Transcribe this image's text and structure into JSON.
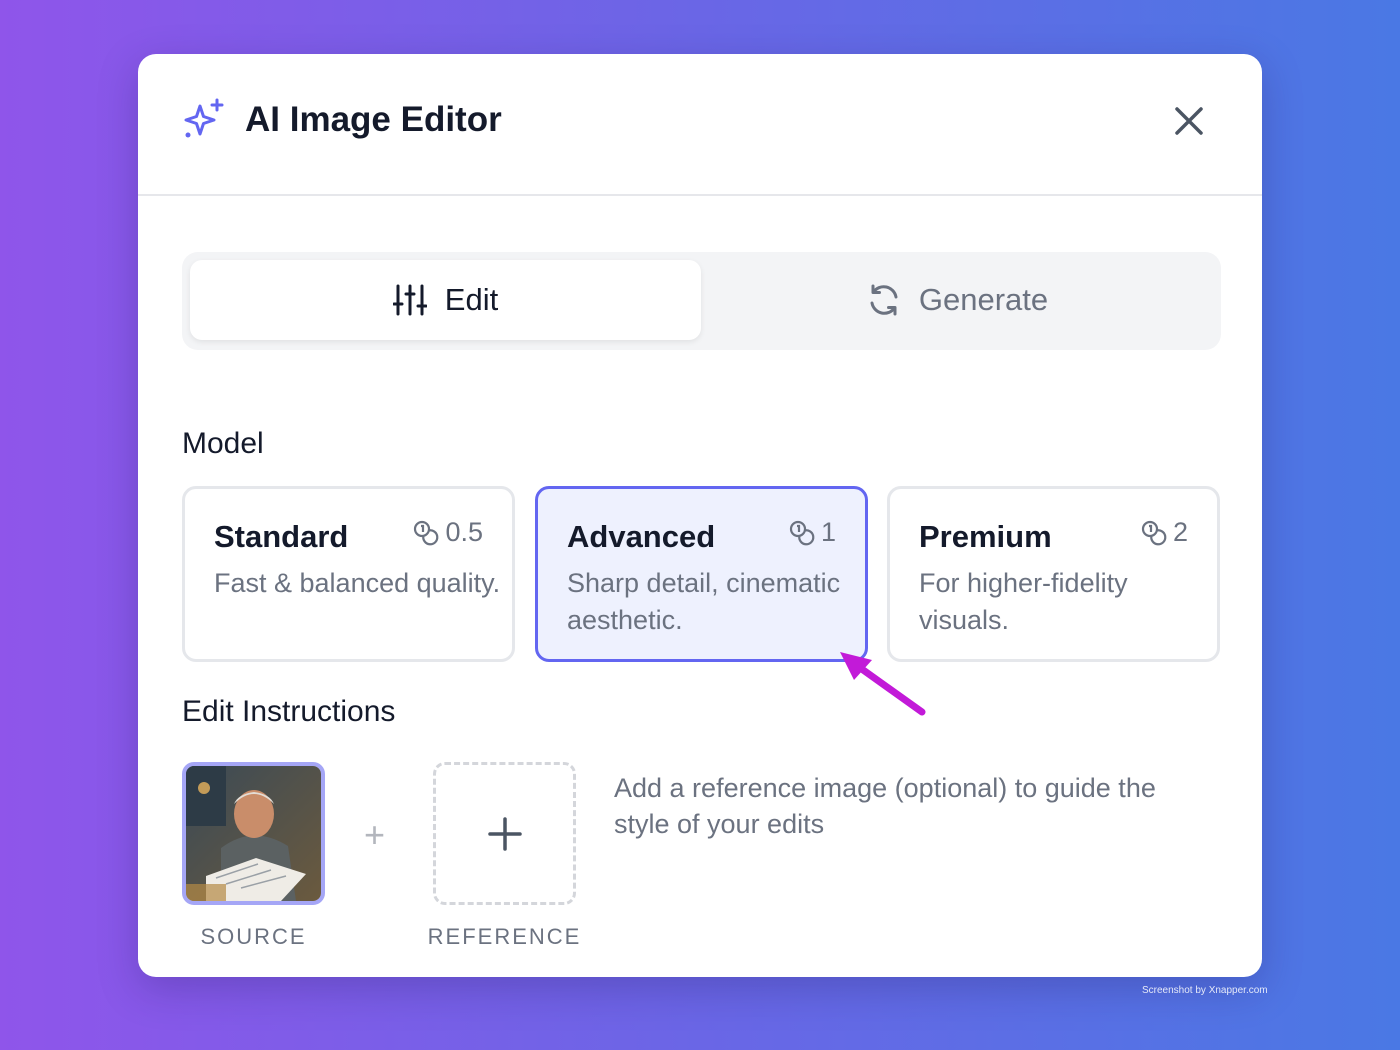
{
  "dialog": {
    "title": "AI Image Editor"
  },
  "tabs": [
    {
      "label": "Edit",
      "icon": "sliders-icon",
      "active": true
    },
    {
      "label": "Generate",
      "icon": "refresh-icon",
      "active": false
    }
  ],
  "model": {
    "label": "Model",
    "options": [
      {
        "name": "Standard",
        "cost": "0.5",
        "description": "Fast & balanced quality.",
        "selected": false
      },
      {
        "name": "Advanced",
        "cost": "1",
        "description": "Sharp detail, cinematic aesthetic.",
        "selected": true
      },
      {
        "name": "Premium",
        "cost": "2",
        "description": "For higher-fidelity visuals.",
        "selected": false
      }
    ]
  },
  "edit_instructions": {
    "label": "Edit Instructions",
    "source_caption": "SOURCE",
    "reference_caption": "REFERENCE",
    "separator": "+",
    "hint": "Add a reference image (optional) to guide the style of your edits"
  },
  "watermark": "Screenshot by Xnapper.com",
  "colors": {
    "accent": "#6366f1",
    "selected_bg": "#eef1fe",
    "annotation_arrow": "#c21ad8"
  }
}
